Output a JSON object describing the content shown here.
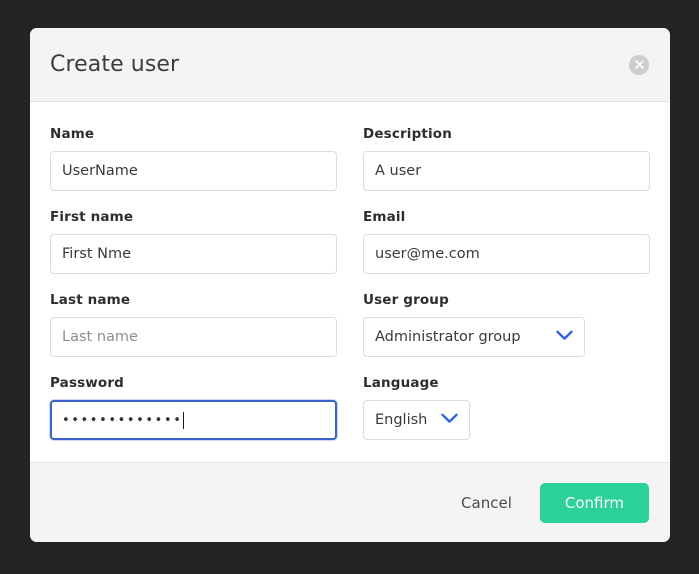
{
  "dialog": {
    "title": "Create user",
    "close_icon": "close-icon"
  },
  "form": {
    "fields": [
      {
        "name": "name",
        "label": "Name",
        "type": "text",
        "value": "UserName",
        "placeholder": "Name",
        "is_placeholder": false,
        "focused": false
      },
      {
        "name": "description",
        "label": "Description",
        "type": "text",
        "value": "A user",
        "placeholder": "Description",
        "is_placeholder": false,
        "focused": false
      },
      {
        "name": "first_name",
        "label": "First name",
        "type": "text",
        "value": "First Nme",
        "placeholder": "First name",
        "is_placeholder": false,
        "focused": false
      },
      {
        "name": "email",
        "label": "Email",
        "type": "text",
        "value": "user@me.com",
        "placeholder": "Email",
        "is_placeholder": false,
        "focused": false
      },
      {
        "name": "last_name",
        "label": "Last name",
        "type": "text",
        "value": "",
        "placeholder": "Last name",
        "is_placeholder": true,
        "focused": false
      },
      {
        "name": "user_group",
        "label": "User group",
        "type": "select",
        "value": "Administrator group",
        "chevron_icon": "chevron-down-icon",
        "options": [
          "Administrator group"
        ]
      },
      {
        "name": "password",
        "label": "Password",
        "type": "password",
        "masked_value": "•••••••••••••",
        "character_count": 13,
        "focused": true
      },
      {
        "name": "language",
        "label": "Language",
        "type": "select",
        "value": "English",
        "chevron_icon": "chevron-down-icon",
        "options": [
          "English"
        ]
      }
    ]
  },
  "footer": {
    "cancel_label": "Cancel",
    "confirm_label": "Confirm"
  },
  "colors": {
    "backdrop": "#242424",
    "dialog_bg": "#ffffff",
    "header_bg": "#f4f4f4",
    "footer_bg": "#f4f4f4",
    "confirm_green": "#2bd09b",
    "focus_blue": "#3a64c8",
    "chevron_blue": "#2f62e0",
    "input_border": "#dcdcdc",
    "label_text": "#2e2e2e",
    "value_text": "#3a3a3a",
    "placeholder_text": "#6e6e6e"
  }
}
